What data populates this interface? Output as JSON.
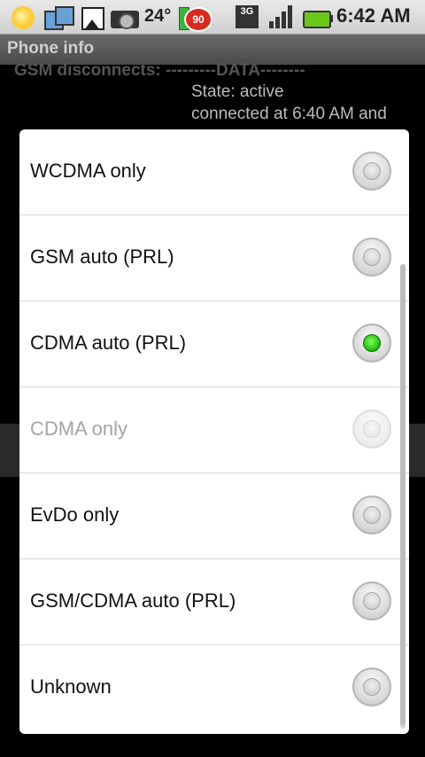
{
  "status_bar": {
    "temperature": "24°",
    "battery_badge": "90",
    "network_type": "3G",
    "time": "6:42 AM"
  },
  "title_bar": {
    "title": "Phone info"
  },
  "background": {
    "gsm_line": "GSM disconnects: ---------DATA--------",
    "state_line": "State: active",
    "connected_line": "connected at 6:40 AM and"
  },
  "dialog": {
    "options": [
      {
        "label": "WCDMA only",
        "checked": false,
        "enabled": true
      },
      {
        "label": "GSM auto (PRL)",
        "checked": false,
        "enabled": true
      },
      {
        "label": "CDMA auto (PRL)",
        "checked": true,
        "enabled": true
      },
      {
        "label": "CDMA only",
        "checked": false,
        "enabled": false
      },
      {
        "label": "EvDo only",
        "checked": false,
        "enabled": true
      },
      {
        "label": "GSM/CDMA auto (PRL)",
        "checked": false,
        "enabled": true
      },
      {
        "label": "Unknown",
        "checked": false,
        "enabled": true
      }
    ]
  },
  "icons": {
    "status": [
      "sun-weather-icon",
      "photos-icon",
      "gallery-icon",
      "camera-icon",
      "battery-app-icon",
      "3g-data-icon",
      "signal-strength-icon",
      "battery-icon"
    ]
  },
  "colors": {
    "radio_checked": "#1eb80a",
    "status_bar": "#dcdcdc",
    "dialog_bg": "#ffffff"
  }
}
